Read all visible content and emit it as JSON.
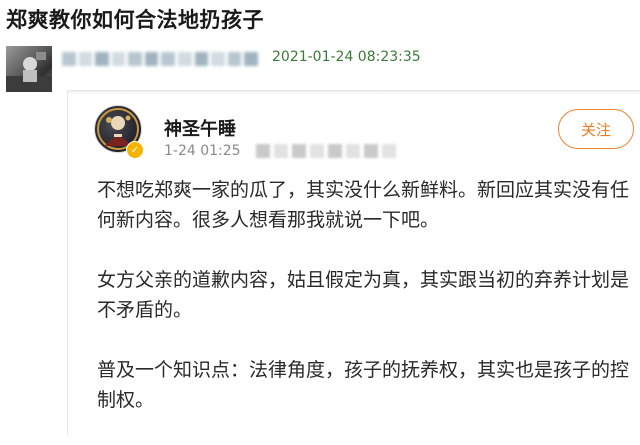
{
  "article": {
    "title": "郑爽教你如何合法地扔孩子"
  },
  "poster": {
    "timestamp": "2021-01-24 08:23:35"
  },
  "post": {
    "user_name": "神圣午睡",
    "time": "1-24 01:25",
    "follow_label": "关注",
    "paragraphs": [
      "不想吃郑爽一家的瓜了，其实没什么新鲜料。新回应其实没有任何新内容。很多人想看那我就说一下吧。",
      "女方父亲的道歉内容，姑且假定为真，其实跟当初的弃养计划是不矛盾的。",
      "普及一个知识点：法律角度，孩子的抚养权，其实也是孩子的控制权。"
    ]
  },
  "colors": {
    "follow_accent": "#f0832c",
    "timestamp_green": "#3a7a3a",
    "verified_badge": "#f4b400"
  },
  "icons": [
    "verified-icon"
  ]
}
